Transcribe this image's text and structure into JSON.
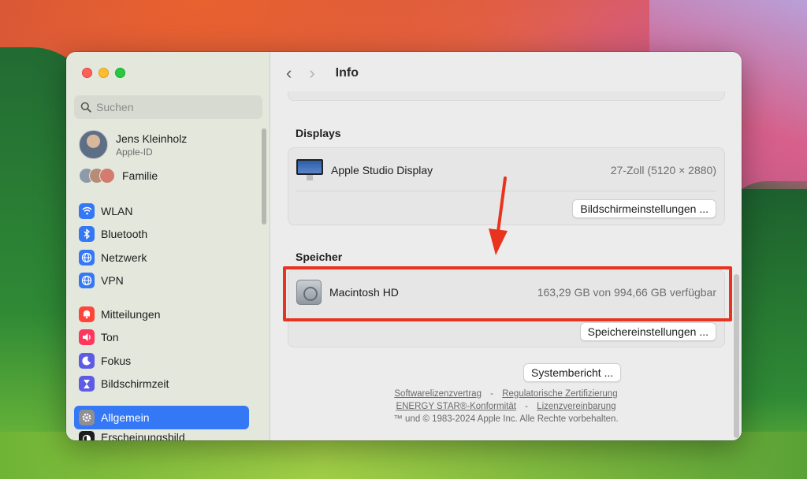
{
  "sidebar": {
    "search_placeholder": "Suchen",
    "account": {
      "name": "Jens Kleinholz",
      "subtitle": "Apple-ID"
    },
    "family_label": "Familie",
    "group1": [
      {
        "label": "WLAN",
        "icon": "wifi-icon",
        "color": "#3478f6"
      },
      {
        "label": "Bluetooth",
        "icon": "bluetooth-icon",
        "color": "#3478f6"
      },
      {
        "label": "Netzwerk",
        "icon": "globe-icon",
        "color": "#3478f6"
      },
      {
        "label": "VPN",
        "icon": "vpn-globe-icon",
        "color": "#3478f6"
      }
    ],
    "group2": [
      {
        "label": "Mitteilungen",
        "icon": "bell-icon",
        "color": "#ff453a"
      },
      {
        "label": "Ton",
        "icon": "speaker-icon",
        "color": "#ff375f"
      },
      {
        "label": "Fokus",
        "icon": "moon-icon",
        "color": "#5e5ce6"
      },
      {
        "label": "Bildschirmzeit",
        "icon": "hourglass-icon",
        "color": "#5e5ce6"
      }
    ],
    "group3": [
      {
        "label": "Allgemein",
        "icon": "gear-icon",
        "color": "#8e8e93",
        "active": true
      },
      {
        "label": "Erscheinungsbild",
        "icon": "appearance-icon",
        "color": "#1d1d1f"
      }
    ]
  },
  "toolbar": {
    "back": "‹",
    "forward": "›",
    "title": "Info"
  },
  "displays": {
    "section_title": "Displays",
    "name": "Apple Studio Display",
    "spec": "27-Zoll (5120 × 2880)",
    "button_label": "Bildschirmeinstellungen ..."
  },
  "storage": {
    "section_title": "Speicher",
    "name": "Macintosh HD",
    "value": "163,29 GB von 994,66 GB verfügbar",
    "button_label": "Speichereinstellungen ..."
  },
  "system_report_label": "Systembericht ...",
  "footer": {
    "link1": "Softwarelizenzvertrag",
    "link2": "Regulatorische Zertifizierung",
    "link3": "ENERGY STAR®-Konformität",
    "link4": "Lizenzvereinbarung",
    "sep": "-",
    "copyright": "™ und © 1983-2024 Apple Inc. Alle Rechte vorbehalten."
  },
  "accents": {
    "highlight": "#e8341f",
    "selection": "#3478f6"
  }
}
